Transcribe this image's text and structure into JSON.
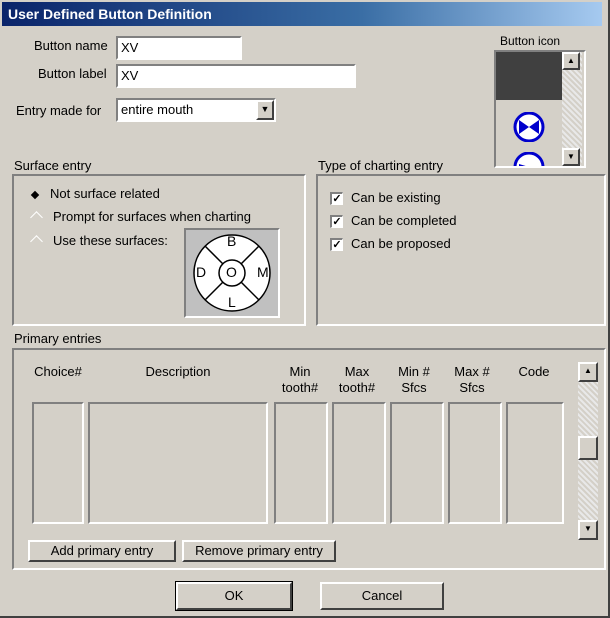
{
  "window": {
    "title": "User Defined Button Definition"
  },
  "fields": {
    "button_name_label": "Button name",
    "button_name_value": "XV",
    "button_label_label": "Button label",
    "button_label_value": "XV",
    "entry_made_for_label": "Entry made for",
    "entry_made_for_value": "entire mouth"
  },
  "button_icon": {
    "label": "Button icon"
  },
  "surface_entry": {
    "title": "Surface entry",
    "options": [
      {
        "label": "Not surface related",
        "selected": true
      },
      {
        "label": "Prompt for surfaces when charting",
        "selected": false
      },
      {
        "label": "Use these surfaces:",
        "selected": false
      }
    ],
    "tooth_surfaces": {
      "top": "B",
      "left": "D",
      "center": "O",
      "right": "M",
      "bottom": "L"
    }
  },
  "charting_type": {
    "title": "Type of charting entry",
    "options": [
      {
        "label": "Can be existing",
        "checked": true
      },
      {
        "label": "Can be completed",
        "checked": true
      },
      {
        "label": "Can be proposed",
        "checked": true
      }
    ]
  },
  "primary_entries": {
    "title": "Primary entries",
    "columns": [
      "Choice#",
      "Description",
      "Min tooth#",
      "Max tooth#",
      "Min # Sfcs",
      "Max # Sfcs",
      "Code"
    ],
    "add_button": "Add primary entry",
    "remove_button": "Remove primary entry"
  },
  "footer": {
    "ok": "OK",
    "cancel": "Cancel"
  },
  "colors": {
    "face": "#d4d0c8",
    "title_start": "#0a246a",
    "title_end": "#a6caf0",
    "icon_blue": "#0000cc"
  }
}
